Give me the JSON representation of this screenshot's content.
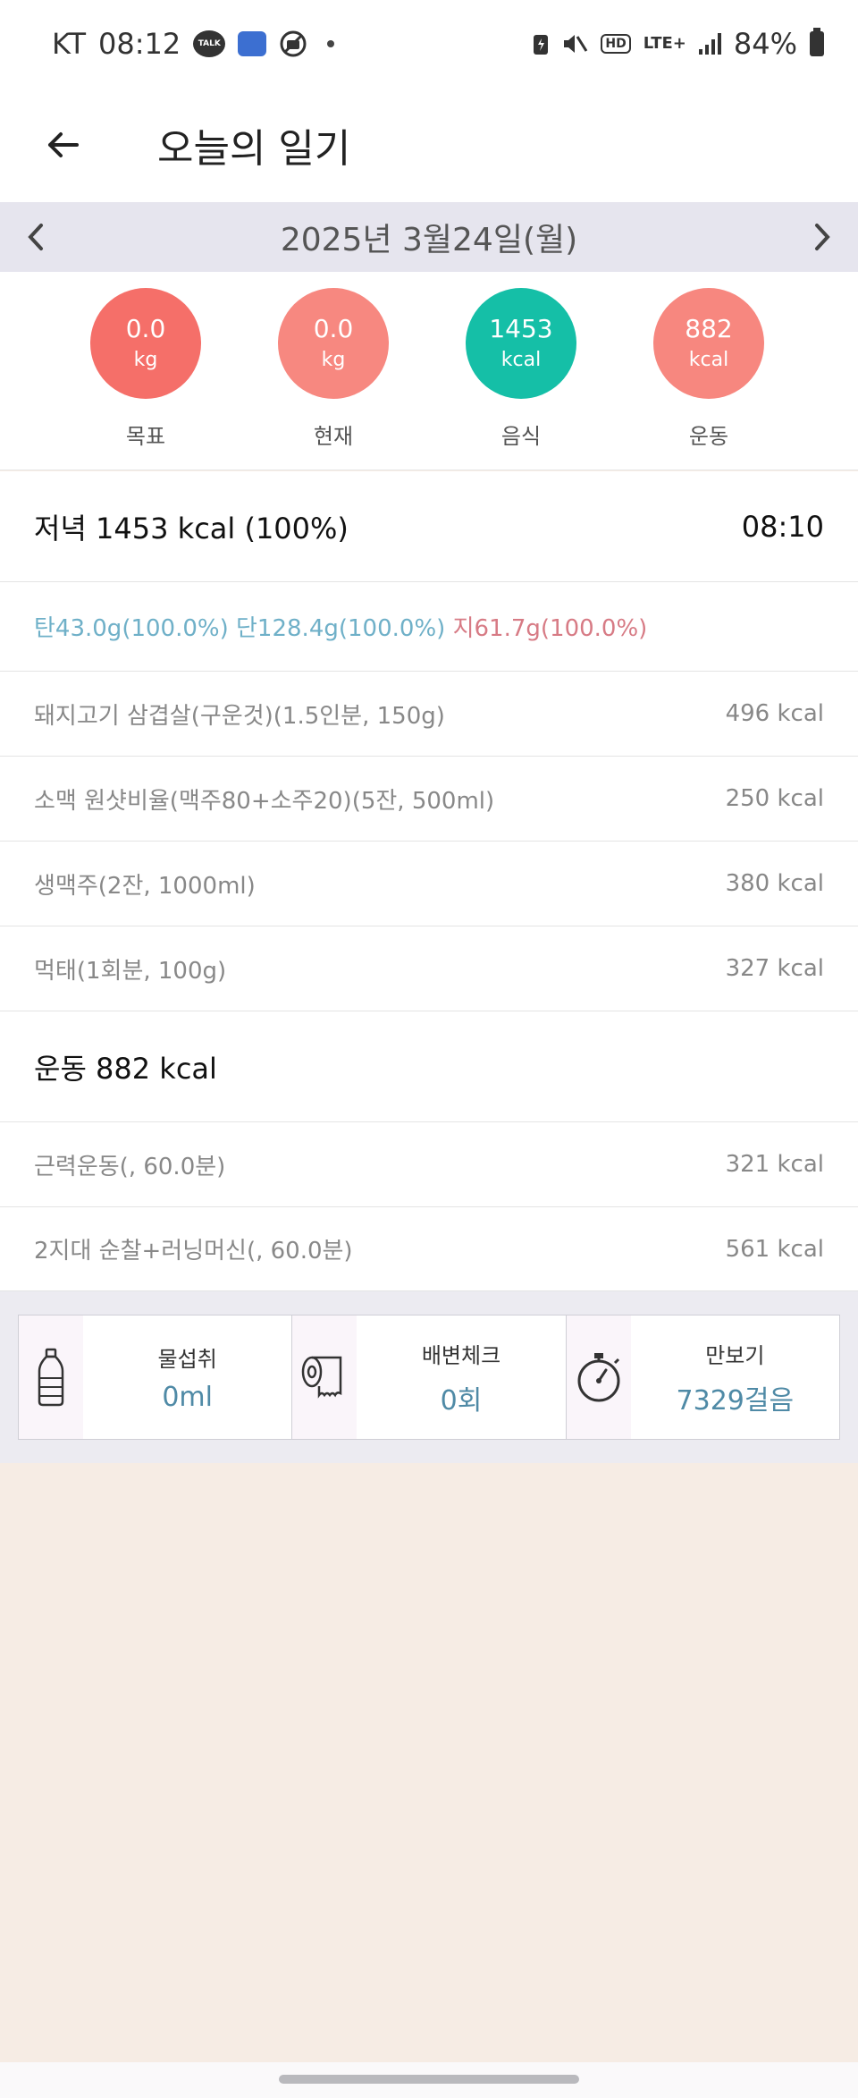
{
  "status_bar": {
    "carrier": "KT",
    "time": "08:12",
    "talk_badge": "TALK",
    "hd_label": "HD",
    "network": "LTE+",
    "battery": "84%"
  },
  "header": {
    "title": "오늘의 일기"
  },
  "date_bar": {
    "date": "2025년 3월24일(월)"
  },
  "summary": [
    {
      "value": "0.0",
      "unit": "kg",
      "label": "목표",
      "color": "#f56f69"
    },
    {
      "value": "0.0",
      "unit": "kg",
      "label": "현재",
      "color": "#f78880"
    },
    {
      "value": "1453",
      "unit": "kcal",
      "label": "음식",
      "color": "#15bfa7"
    },
    {
      "value": "882",
      "unit": "kcal",
      "label": "운동",
      "color": "#f7877f"
    }
  ],
  "meal": {
    "title": "저녁 1453 kcal (100%)",
    "time": "08:10",
    "macros": {
      "carb": "탄43.0g(100.0%)",
      "protein": "단128.4g(100.0%)",
      "fat": "지61.7g(100.0%)"
    },
    "items": [
      {
        "name": "돼지고기 삼겹살(구운것)(1.5인분, 150g)",
        "kcal": "496 kcal"
      },
      {
        "name": "소맥 원샷비율(맥주80+소주20)(5잔, 500ml)",
        "kcal": "250 kcal"
      },
      {
        "name": "생맥주(2잔, 1000ml)",
        "kcal": "380 kcal"
      },
      {
        "name": "먹태(1회분, 100g)",
        "kcal": "327 kcal"
      }
    ]
  },
  "exercise": {
    "title": "운동 882 kcal",
    "items": [
      {
        "name": "근력운동(, 60.0분)",
        "kcal": "321 kcal"
      },
      {
        "name": "2지대 순찰+러닝머신(, 60.0분)",
        "kcal": "561 kcal"
      }
    ]
  },
  "trackers": [
    {
      "icon": "water-bottle-icon",
      "label": "물섭취",
      "value": "0ml"
    },
    {
      "icon": "toilet-paper-icon",
      "label": "배변체크",
      "value": "0회"
    },
    {
      "icon": "stopwatch-icon",
      "label": "만보기",
      "value": "7329걸음"
    }
  ]
}
